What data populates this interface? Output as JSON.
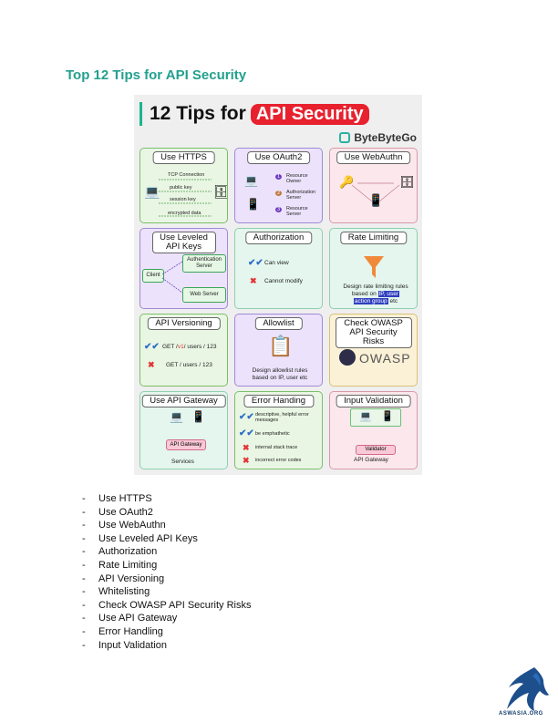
{
  "heading": "Top 12 Tips for API Security",
  "poster": {
    "title": "12 Tips for",
    "title_highlight": "API Security",
    "brand": "ByteByteGo",
    "cards": {
      "https": {
        "title": "Use HTTPS",
        "l1": "TCP Connection",
        "l2": "public key",
        "l3": "session key",
        "l4": "encrypted data"
      },
      "oauth2": {
        "title": "Use OAuth2",
        "l1": "Resource Owner",
        "l2": "Authorization Server",
        "l3": "Resource Server",
        "n1": "1",
        "n2": "2",
        "n3": "3"
      },
      "webauthn": {
        "title": "Use WebAuthn"
      },
      "apikeys": {
        "title": "Use Leveled API Keys",
        "client": "Client",
        "auth": "Authentication Server",
        "web": "Web Server"
      },
      "authz": {
        "title": "Authorization",
        "can": "Can view",
        "cannot": "Cannot modify"
      },
      "rate": {
        "title": "Rate Limiting",
        "desc1": "Design rate limiting rules",
        "desc2": "based on",
        "hl1": "IP, user",
        "hl2": "action group",
        "desc3": "etc"
      },
      "versioning": {
        "title": "API Versioning",
        "good_pre": "GET /",
        "good_hl": "v1",
        "good_post": "/ users / 123",
        "bad": "GET / users / 123"
      },
      "allowlist": {
        "title": "Allowlist",
        "desc1": "Design allowlist rules",
        "desc2": "based on IP, user etc"
      },
      "owasp": {
        "title": "Check OWASP API Security Risks",
        "logo": "OWASP"
      },
      "gateway": {
        "title": "Use API Gateway",
        "gw": "API Gateway",
        "services": "Services"
      },
      "errors": {
        "title": "Error Handing",
        "e1": "descriptive, helpful error messages",
        "e2": "be emphathetic",
        "e3": "internal stack trace",
        "e4": "incorrect error codes"
      },
      "validation": {
        "title": "Input Validation",
        "validator": "Validator",
        "gw": "API Gateway"
      }
    }
  },
  "bullets": [
    "Use HTTPS",
    "Use OAuth2",
    "Use WebAuthn",
    "Use Leveled API Keys",
    "Authorization",
    "Rate Limiting",
    "API Versioning",
    "Whitelisting",
    "Check OWASP API Security Risks",
    "Use API Gateway",
    "Error Handling",
    "Input Validation"
  ],
  "logo_text": "ASWASIA.ORG",
  "colors": {
    "heading": "#23a08e",
    "highlight": "#e8212e",
    "green_card": "#e9f6e3",
    "purple_card": "#ece2fb",
    "pink_card": "#fbe7ec",
    "mint_card": "#e4f6ee",
    "yellow_card": "#fbf1d6"
  }
}
